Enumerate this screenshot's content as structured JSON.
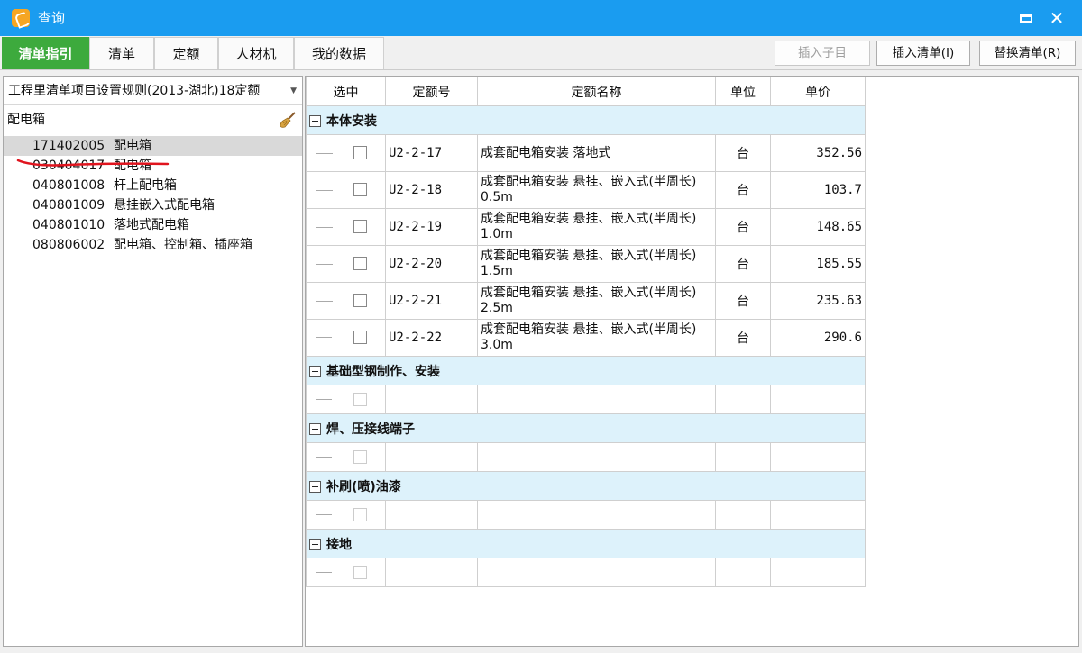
{
  "window": {
    "title": "查询"
  },
  "tabs": [
    "清单指引",
    "清单",
    "定额",
    "人材机",
    "我的数据"
  ],
  "toolbar": {
    "insert_child": "插入子目",
    "insert_list": "插入清单(I)",
    "replace_list": "替换清单(R)"
  },
  "left": {
    "rule": "工程里清单项目设置规则(2013-湖北)18定额",
    "search": "配电箱",
    "items": [
      {
        "code": "171402005",
        "name": "配电箱"
      },
      {
        "code": "030404017",
        "name": "配电箱"
      },
      {
        "code": "040801008",
        "name": "杆上配电箱"
      },
      {
        "code": "040801009",
        "name": "悬挂嵌入式配电箱"
      },
      {
        "code": "040801010",
        "name": "落地式配电箱"
      },
      {
        "code": "080806002",
        "name": "配电箱、控制箱、插座箱"
      }
    ]
  },
  "grid": {
    "headers": [
      "选中",
      "定额号",
      "定额名称",
      "单位",
      "单价"
    ],
    "groups": [
      {
        "name": "本体安装",
        "rows": [
          {
            "code": "U2-2-17",
            "name": "成套配电箱安装 落地式",
            "unit": "台",
            "price": "352.56"
          },
          {
            "code": "U2-2-18",
            "name": "成套配电箱安装 悬挂、嵌入式(半周长) 0.5m",
            "unit": "台",
            "price": "103.7"
          },
          {
            "code": "U2-2-19",
            "name": "成套配电箱安装 悬挂、嵌入式(半周长) 1.0m",
            "unit": "台",
            "price": "148.65"
          },
          {
            "code": "U2-2-20",
            "name": "成套配电箱安装 悬挂、嵌入式(半周长) 1.5m",
            "unit": "台",
            "price": "185.55"
          },
          {
            "code": "U2-2-21",
            "name": "成套配电箱安装 悬挂、嵌入式(半周长) 2.5m",
            "unit": "台",
            "price": "235.63"
          },
          {
            "code": "U2-2-22",
            "name": "成套配电箱安装 悬挂、嵌入式(半周长) 3.0m",
            "unit": "台",
            "price": "290.6"
          }
        ]
      },
      {
        "name": "基础型钢制作、安装",
        "rows": []
      },
      {
        "name": "焊、压接线端子",
        "rows": []
      },
      {
        "name": "补刷(喷)油漆",
        "rows": []
      },
      {
        "name": "接地",
        "rows": []
      }
    ]
  }
}
